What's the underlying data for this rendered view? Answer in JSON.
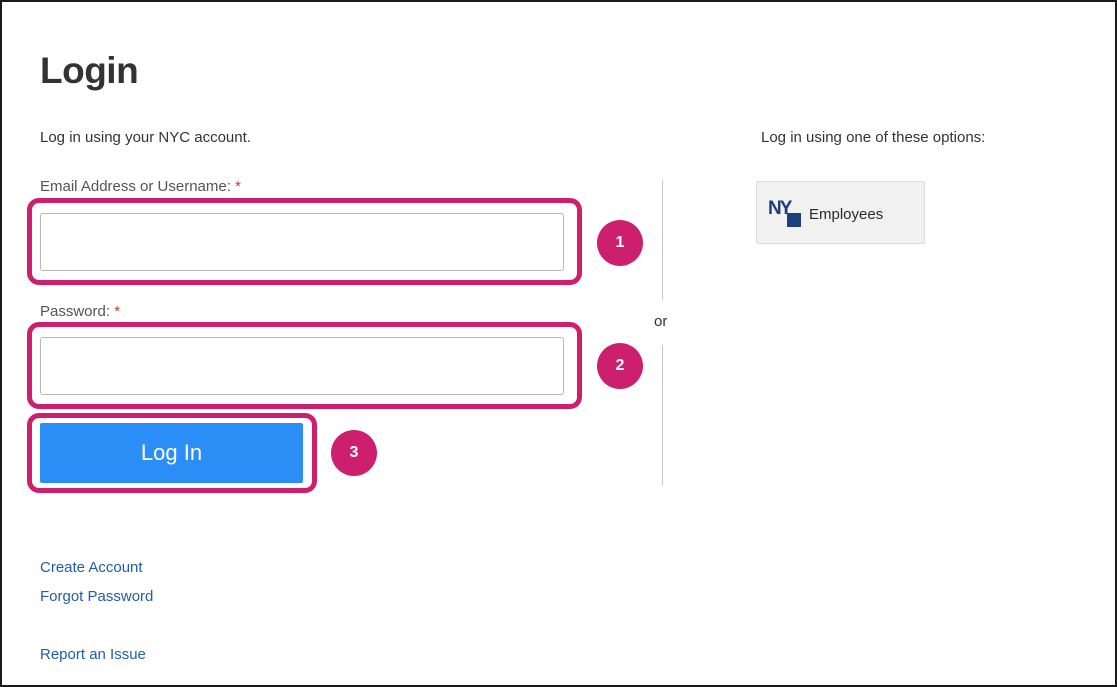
{
  "page": {
    "title": "Login",
    "left_subtitle": "Log in using your NYC account.",
    "right_subtitle": "Log in using one of these options:"
  },
  "form": {
    "email_label": "Email Address or Username:",
    "password_label": "Password:",
    "required_marker": "*",
    "email_value": "",
    "password_value": "",
    "login_button": "Log In"
  },
  "divider": {
    "or_text": "or"
  },
  "sso": {
    "nyc_logo": "NYC",
    "employees_label": "Employees"
  },
  "annotations": [
    "1",
    "2",
    "3"
  ],
  "links": {
    "create_account": "Create Account",
    "forgot_password": "Forgot Password",
    "report_issue": "Report an Issue"
  },
  "colors": {
    "highlight": "#cc1f6d",
    "primary_button": "#2b8ef7",
    "link": "#1f5fa8",
    "nyc_logo": "#1b3f7a"
  }
}
